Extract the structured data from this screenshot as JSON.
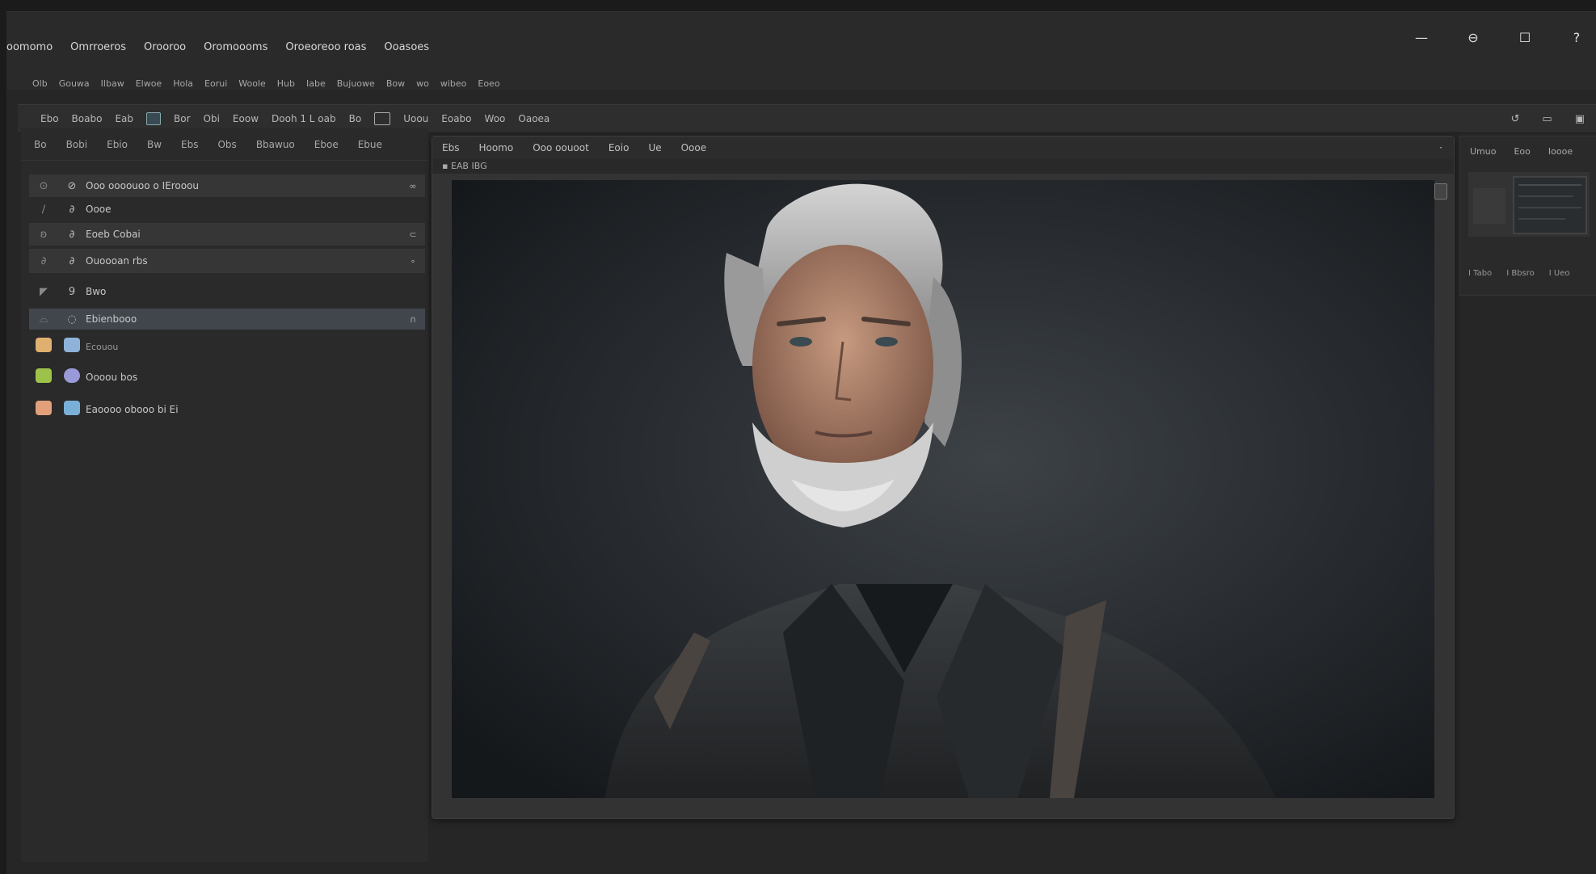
{
  "menubar": {
    "items": [
      "oomomo",
      "Omrroeros",
      "Orooroo",
      "Oromoooms",
      "Oroeoreoo roas",
      "Ooasoes"
    ],
    "sub_items": [
      "Olb",
      "Gouwa",
      "Ilbaw",
      "Elwoe",
      "Hola",
      "Eorui",
      "Woole",
      "Hub",
      "Iabe",
      "Bujuowe",
      "Bow",
      "wo",
      "wibeo",
      "Eoeo"
    ]
  },
  "window_controls": [
    "—",
    "⊖",
    "☐",
    "?"
  ],
  "toolbar": {
    "items": [
      "Ebo",
      "Boabo",
      "Eab",
      "Bor",
      "Obi",
      "Eoow",
      "Dooh 1 L oab",
      "Bo",
      "Uoou",
      "Eoabo",
      "Woo",
      "Oaoea"
    ],
    "right_icons": [
      "↺",
      "▭",
      "▣"
    ]
  },
  "left_panel": {
    "tabs": [
      "Bo",
      "Bobi",
      "Ebio",
      "Bw",
      "Ebs",
      "Obs",
      "Bbawuo",
      "Eboe",
      "Ebue"
    ],
    "layers": [
      {
        "icon_a": "⊙",
        "icon_b": "⊘",
        "name": "Ooo oooouoo o IErooou",
        "end": "∞"
      },
      {
        "icon_a": "∕",
        "icon_b": "∂",
        "name": "Oooe",
        "end": ""
      },
      {
        "icon_a": "ʚ",
        "icon_b": "∂",
        "name": "Eoeb Cobai",
        "end": "⊂"
      },
      {
        "icon_a": "∂",
        "icon_b": "∂",
        "name": "Ouoooan rbs",
        "end": "∘"
      },
      {
        "icon_a": "◤",
        "icon_b": "9",
        "name": "Bwo",
        "end": ""
      },
      {
        "icon_a": "⌓",
        "icon_b": "◌",
        "name": "Ebienbooo",
        "end": "∩"
      },
      {
        "icon_a": "thumb",
        "icon_b": "thumb",
        "name": "Ecouou",
        "end": ""
      },
      {
        "icon_a": "thumb",
        "icon_b": "thumb",
        "name": "Oooou bos",
        "end": ""
      },
      {
        "icon_a": "thumb",
        "icon_b": "thumb",
        "name": "Eaoooo obooo bi Ei",
        "end": ""
      }
    ]
  },
  "canvas": {
    "tabs": [
      "Ebs",
      "Hoomo",
      "Ooo oouoot",
      "Eoio",
      "Ue",
      "Oooe"
    ],
    "filename": "EAB IBG",
    "tab_close": "·"
  },
  "right_panel": {
    "tabs": [
      "Umuo",
      "Eoo",
      "Ioooe"
    ],
    "bottom": [
      "I Tabo",
      "I Bbsro",
      "I Ueo"
    ]
  },
  "colors": {
    "background": "#262626",
    "panel": "#2a2a2a",
    "selection": "#41464d",
    "thumb_orange": "#e0b070",
    "thumb_green": "#9cc24a",
    "thumb_blue": "#7ab0d8",
    "thumb_purple": "#9a9ad8"
  }
}
